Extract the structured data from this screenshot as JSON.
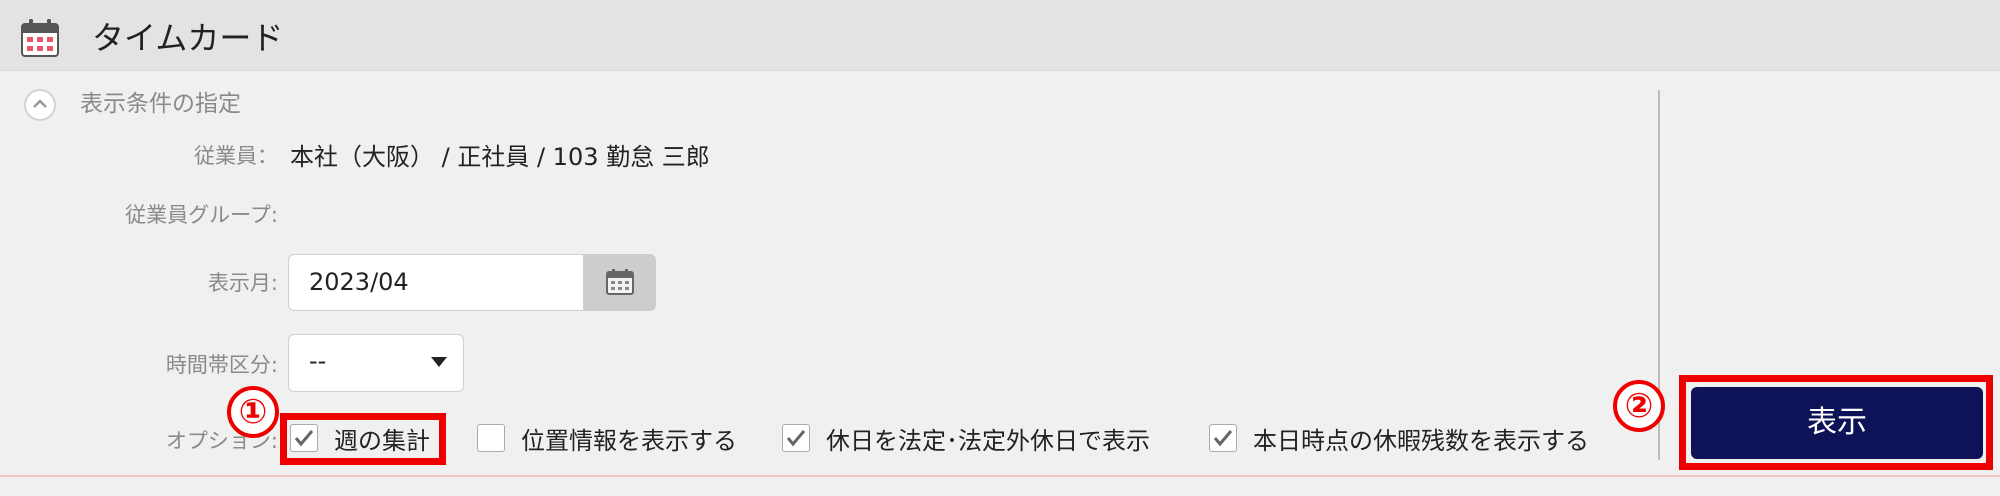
{
  "header": {
    "title": "タイムカード",
    "icon": "calendar-icon"
  },
  "section": {
    "title": "表示条件の指定",
    "toggle_icon": "chevron-up-icon"
  },
  "fields": {
    "employee": {
      "label": "従業員：",
      "value": "本社（大阪） / 正社員 / 103 勤怠 三郎"
    },
    "employee_group": {
      "label": "従業員グループ:",
      "value": ""
    },
    "display_month": {
      "label": "表示月:",
      "value": "2023/04",
      "button_icon": "calendar-icon"
    },
    "time_zone_division": {
      "label": "時間帯区分:",
      "selected": "--"
    },
    "options": {
      "label": "オプション:",
      "items": [
        {
          "label": "週の集計",
          "checked": true
        },
        {
          "label": "位置情報を表示する",
          "checked": false
        },
        {
          "label": "休日を法定･法定外休日で表示",
          "checked": true
        },
        {
          "label": "本日時点の休暇残数を表示する",
          "checked": true
        }
      ]
    }
  },
  "actions": {
    "show_label": "表示"
  },
  "annotations": {
    "marker1": "①",
    "marker2": "②"
  },
  "colors": {
    "accent": "#0d1356",
    "highlight": "#ee0000",
    "header_bg": "#e3e3e3"
  }
}
